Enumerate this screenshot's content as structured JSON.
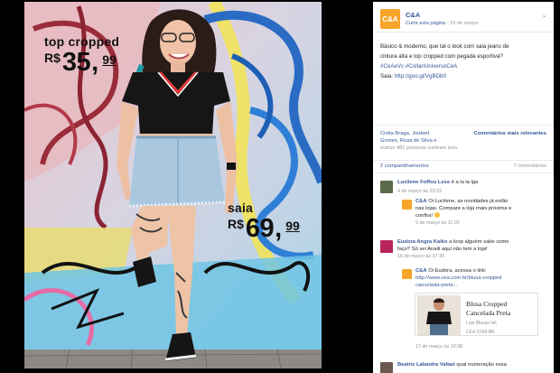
{
  "post": {
    "page_name": "C&A",
    "logo_text": "C&A",
    "like_link": "Curtir esta página",
    "date": "15 de março",
    "globe": "·",
    "menu_icon": "chevron-down-icon",
    "text_line1": "Básico & moderno, que tal o look com saia jeans de",
    "text_line2": "cintura alta e top cropped com pegada esportiva?",
    "hashtags": "#CeAeVc #CollanUniversoCeA",
    "link_prefix": "Saia: ",
    "link": "http://goo.gl/VgBDb0"
  },
  "stats": {
    "names_line1": "Cintia Braga, Joubert",
    "names_line2": "Gomes, Rosa de Silva e",
    "others": "outras 481 pessoas curtiram isso.",
    "sort_label": "Comentários mais relevantes",
    "shares": "2 compartilhamentos",
    "comments": "7 comentários"
  },
  "comments": [
    {
      "name": "Lucilene Foffou Lsss",
      "text": "é a la la lga",
      "time": "4 de março às 20:22"
    },
    {
      "name": "C&A",
      "text_line1": "Oi Lucilene, as novidades já estão",
      "text_line2": "nas lojas. Compare a loja mais próxima e",
      "text_line3": "confira!",
      "time": "5 de março às 11:00"
    },
    {
      "name": "Eudora Angra Kaiko",
      "text_line1": "a loop alguém sabe como",
      "text_line2": "faço? Só sei Anaili aqui não tem a loja!",
      "time": "16 de março às 07:36"
    },
    {
      "name": "C&A",
      "text_line1": "Oi Eudora, acessa o link:",
      "text_line2": "http://www.cea.com.br/blusa-cropped",
      "text_line3": "cancelada-preta...",
      "time": "17 de março às 10:38"
    },
    {
      "name": "Beatriz Lalandra Valtaó",
      "text_line1": "qual numeração essa",
      "time": ""
    }
  ],
  "link_card": {
    "title_line1": "Blusa Cropped",
    "title_line2": "Cancelada Preta",
    "subtitle": "Loja Blusas Ink",
    "domain": "CEA.COM.BR"
  },
  "photo": {
    "tag_top_name": "top cropped",
    "tag_top_currency": "R$",
    "tag_top_int": "35",
    "tag_top_sep": ",",
    "tag_top_dec": "99",
    "tag_saia_name": "saia",
    "tag_saia_currency": "R$",
    "tag_saia_int": "69",
    "tag_saia_sep": ",",
    "tag_saia_dec": "99"
  },
  "colors": {
    "brand": "#f7a529",
    "link": "#365899",
    "meta": "#90949c"
  }
}
